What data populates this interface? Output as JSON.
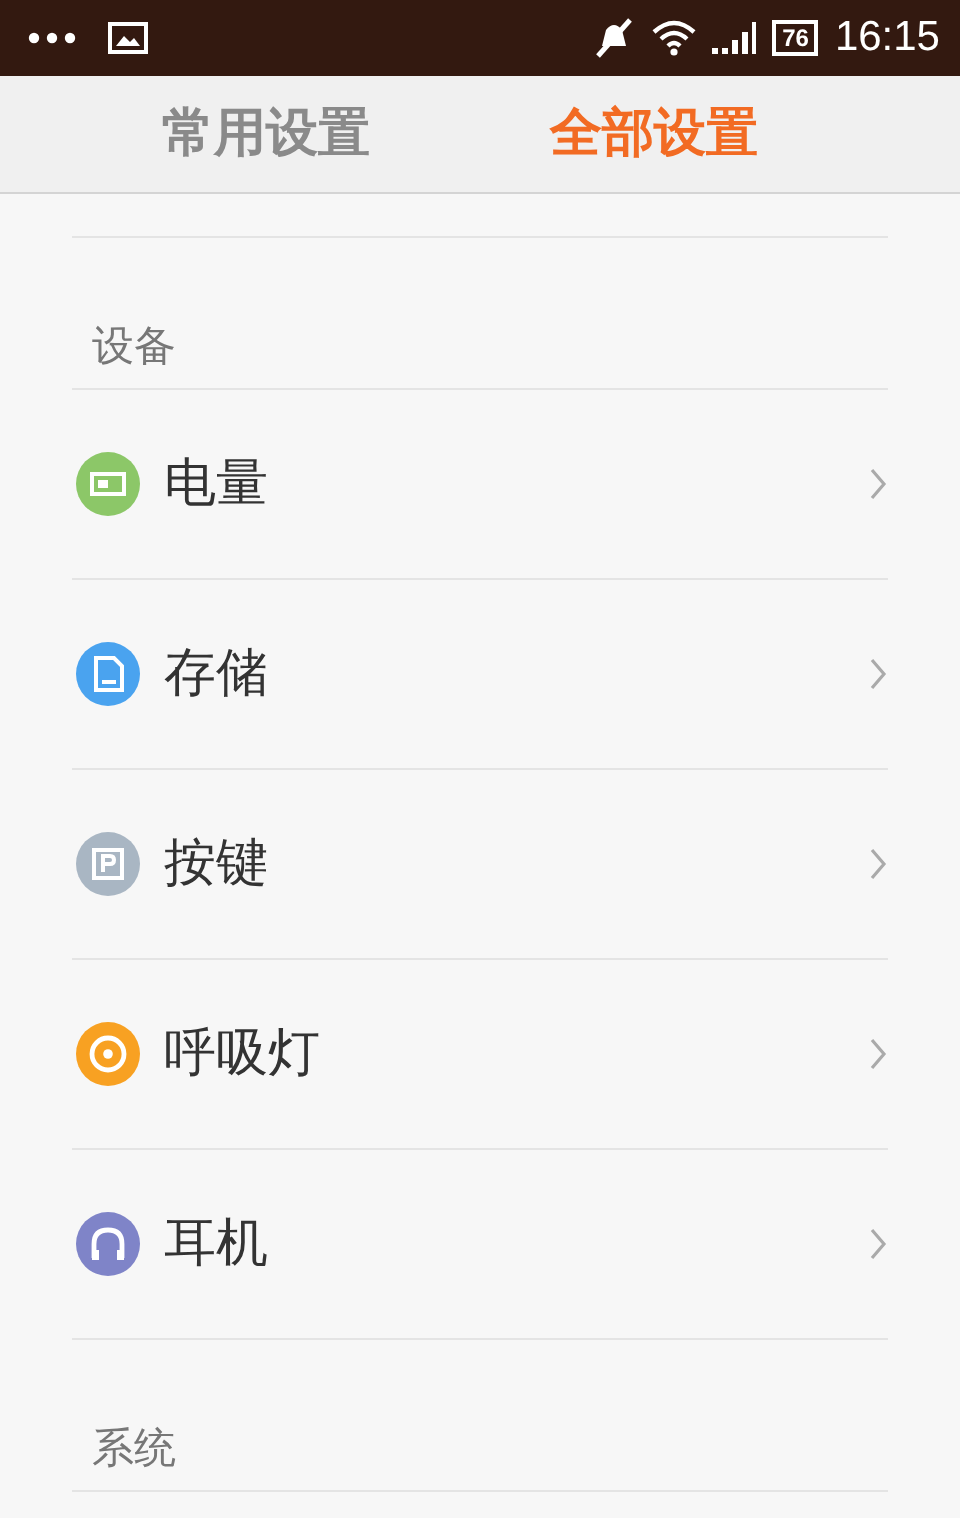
{
  "status_bar": {
    "battery": "76",
    "time": "16:15"
  },
  "tabs": [
    {
      "label": "常用设置",
      "selected": false
    },
    {
      "label": "全部设置",
      "selected": true
    }
  ],
  "sections": [
    {
      "title": "设备",
      "items": [
        {
          "label": "电量",
          "color": "#8cc768"
        },
        {
          "label": "存储",
          "color": "#4aa3ef"
        },
        {
          "label": "按键",
          "color": "#a9b6c3"
        },
        {
          "label": "呼吸灯",
          "color": "#f8a122"
        },
        {
          "label": "耳机",
          "color": "#7f84c8"
        }
      ]
    },
    {
      "title": "系统"
    }
  ]
}
